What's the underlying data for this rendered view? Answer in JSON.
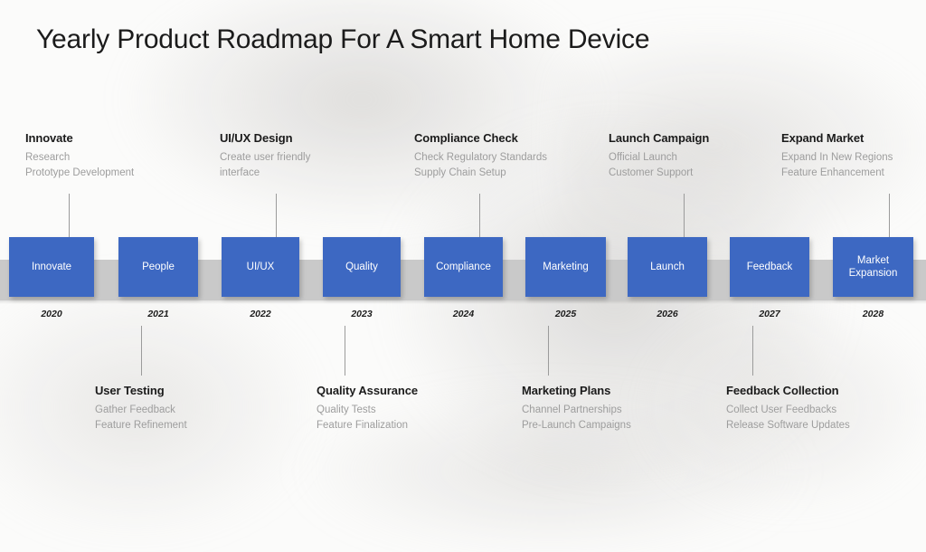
{
  "slide": {
    "title": "Yearly Product Roadmap For A Smart Home Device",
    "accent_color": "#3d68c2",
    "bar_color": "#c9c9c9",
    "background_color": "#fbfbfa",
    "subtext_color": "#9d9d9d"
  },
  "milestones": [
    {
      "box_label": "Innovate",
      "year": "2020"
    },
    {
      "box_label": "People",
      "year": "2021"
    },
    {
      "box_label": "UI/UX",
      "year": "2022"
    },
    {
      "box_label": "Quality",
      "year": "2023"
    },
    {
      "box_label": "Compliance",
      "year": "2024"
    },
    {
      "box_label": "Marketing",
      "year": "2025"
    },
    {
      "box_label": "Launch",
      "year": "2026"
    },
    {
      "box_label": "Feedback",
      "year": "2027"
    },
    {
      "box_label": "Market Expansion",
      "year": "2028"
    }
  ],
  "top_blocks": [
    {
      "heading": "Innovate",
      "line1": "Research",
      "line2": "Prototype Development"
    },
    {
      "heading": "UI/UX Design",
      "line1": "Create user friendly interface",
      "line2": ""
    },
    {
      "heading": "Compliance Check",
      "line1": "Check Regulatory Standards",
      "line2": "Supply Chain Setup"
    },
    {
      "heading": "Launch Campaign",
      "line1": "Official Launch",
      "line2": "Customer Support"
    },
    {
      "heading": "Expand Market",
      "line1": "Expand In New Regions",
      "line2": "Feature Enhancement"
    }
  ],
  "bottom_blocks": [
    {
      "heading": "User Testing",
      "line1": "Gather Feedback",
      "line2": "Feature Refinement"
    },
    {
      "heading": "Quality Assurance",
      "line1": "Quality Tests",
      "line2": "Feature Finalization"
    },
    {
      "heading": "Marketing Plans",
      "line1": "Channel Partnerships",
      "line2": "Pre-Launch Campaigns"
    },
    {
      "heading": "Feedback Collection",
      "line1": "Collect User Feedbacks",
      "line2": "Release Software Updates"
    }
  ]
}
